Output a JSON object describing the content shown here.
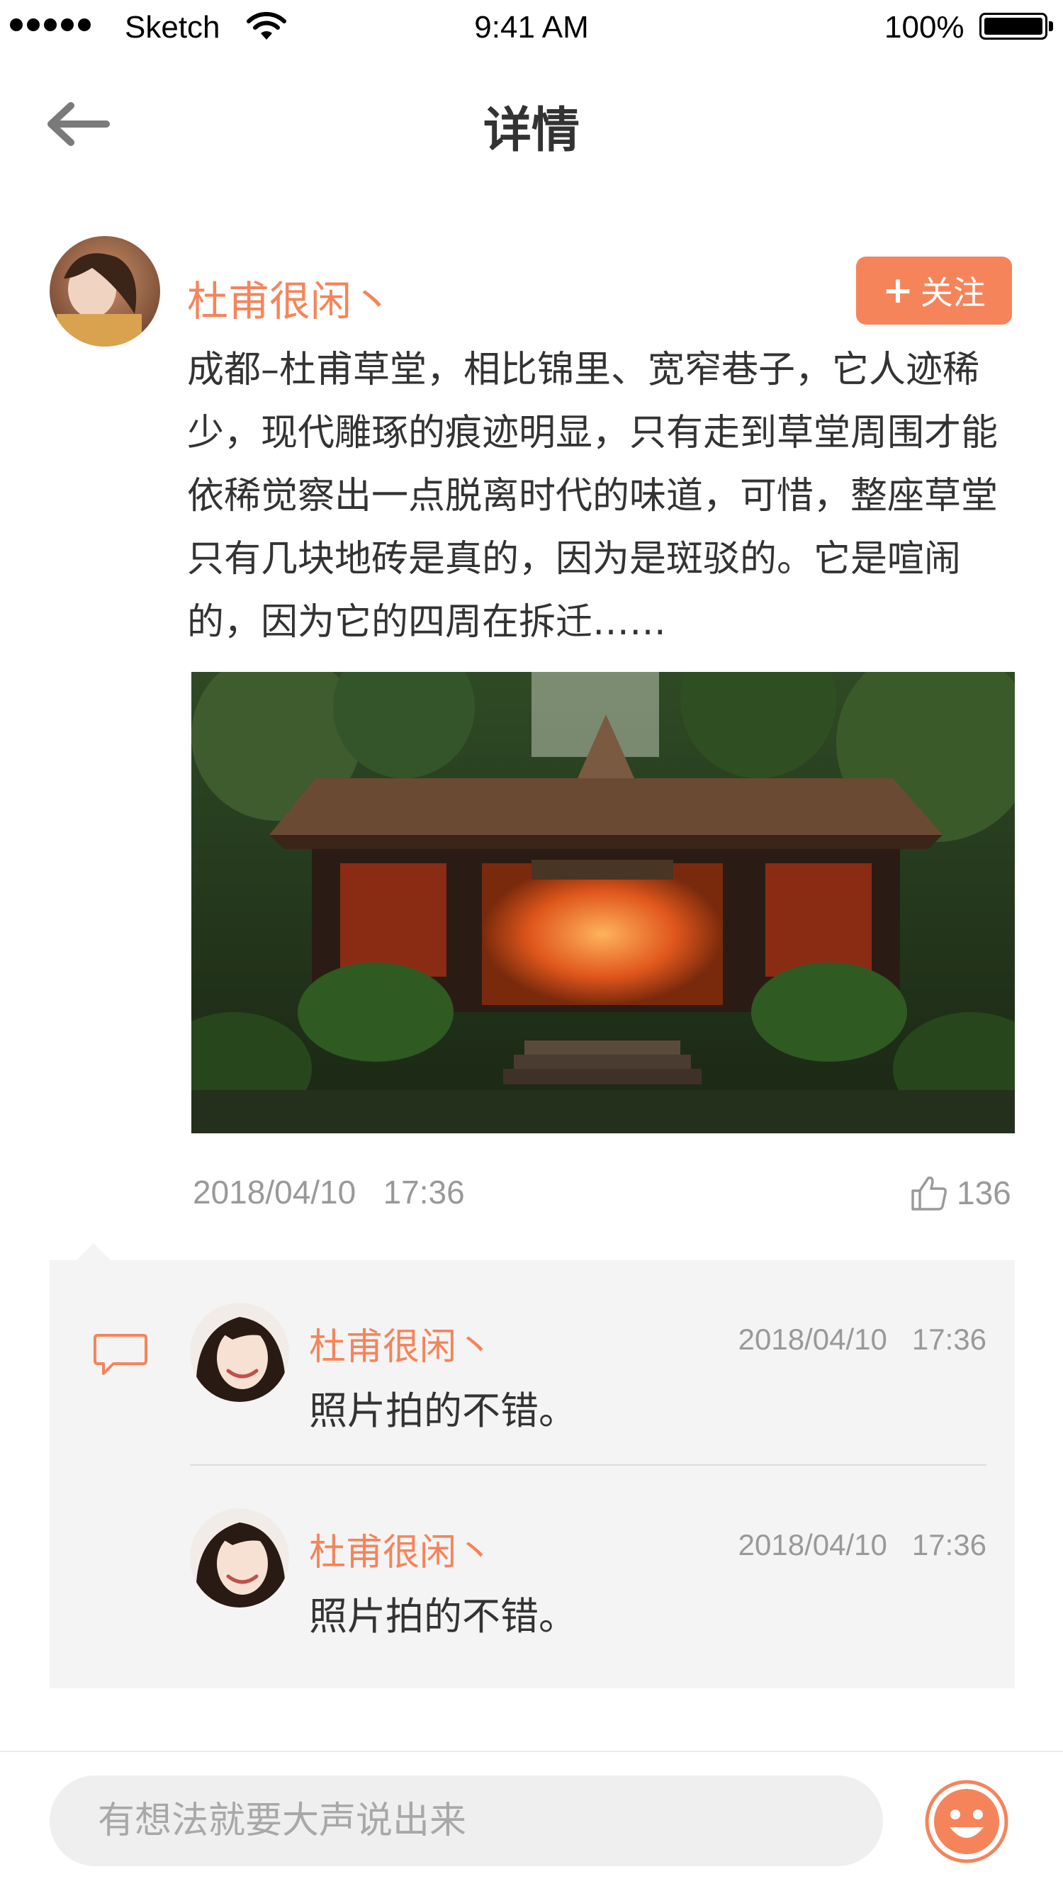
{
  "status_bar": {
    "carrier": "Sketch",
    "time": "9:41 AM",
    "battery": "100%"
  },
  "nav": {
    "title": "详情",
    "back_icon": "arrow-left-icon"
  },
  "post": {
    "author": "杜甫很闲丶",
    "follow_label": "关注",
    "follow_icon": "plus-icon",
    "text": "成都–杜甫草堂，相比锦里、宽窄巷子，它人迹稀少，现代雕琢的痕迹明显，只有走到草堂周围才能依稀觉察出一点脱离时代的味道，可惜，整座草堂只有几块地砖是真的，因为是斑驳的。它是喧闹的，因为它的四周在拆迁……",
    "date": "2018/04/10",
    "time": "17:36",
    "likes": "136",
    "like_icon": "thumbs-up-icon",
    "accent_color": "#f5845a"
  },
  "comments": [
    {
      "author": "杜甫很闲丶",
      "date": "2018/04/10",
      "time": "17:36",
      "text": "照片拍的不错。"
    },
    {
      "author": "杜甫很闲丶",
      "date": "2018/04/10",
      "time": "17:36",
      "text": "照片拍的不错。"
    }
  ],
  "bottom_bar": {
    "placeholder": "有想法就要大声说出来",
    "emoji_icon": "smiley-icon"
  }
}
